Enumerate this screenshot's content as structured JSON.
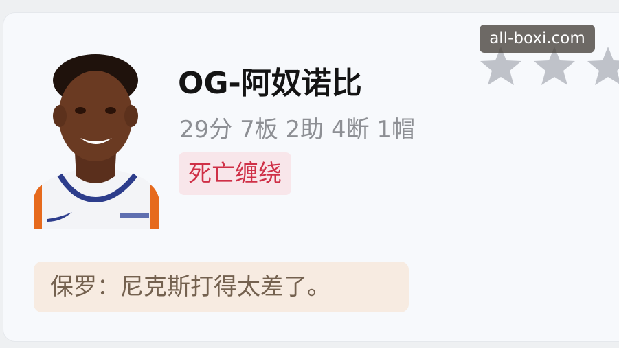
{
  "player": {
    "name": "OG-阿奴诺比",
    "stats": "29分 7板 2助 4断 1帽",
    "tag": "死亡缠绕",
    "quote": "保罗：尼克斯打得太差了。"
  },
  "rating": {
    "stars_visible": 3,
    "icon": "star-icon"
  },
  "watermark": "all-boxi.com",
  "colors": {
    "tag_bg": "#f8e6ea",
    "tag_text": "#cf3047",
    "quote_bg": "#f7ebe1",
    "quote_text": "#74614f",
    "star": "#bfc2c9"
  }
}
